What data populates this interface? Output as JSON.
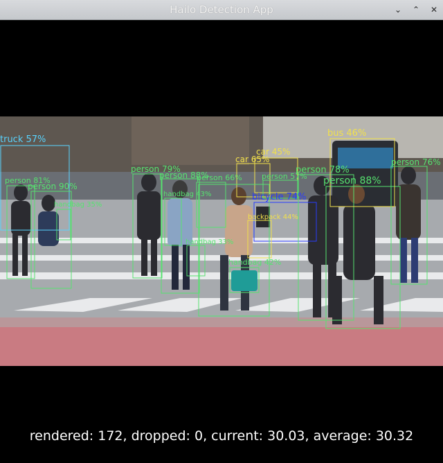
{
  "window": {
    "title": "Hailo Detection App",
    "buttons": [
      {
        "name": "minimize-icon",
        "glyph": "⌄"
      },
      {
        "name": "maximize-icon",
        "glyph": "⌃"
      },
      {
        "name": "close-icon",
        "glyph": "✕"
      }
    ]
  },
  "detections": [
    {
      "label": "truck 57%",
      "color": "#59d4ff"
    },
    {
      "label": "person 81%",
      "color": "#56e36f"
    },
    {
      "label": "person 90%",
      "color": "#56e36f"
    },
    {
      "label": "handbag 35%",
      "color": "#56e36f"
    },
    {
      "label": "person 79%",
      "color": "#56e36f"
    },
    {
      "label": "person 88%",
      "color": "#56e36f"
    },
    {
      "label": "handbag 43%",
      "color": "#56e36f"
    },
    {
      "label": "person 66%",
      "color": "#56e36f"
    },
    {
      "label": "handbag 33%",
      "color": "#56e36f"
    },
    {
      "label": "car 65%",
      "color": "#f2e14b"
    },
    {
      "label": "car 45%",
      "color": "#f2e14b"
    },
    {
      "label": "person 57%",
      "color": "#56e36f"
    },
    {
      "label": "bicycle 74%",
      "color": "#2a3cff"
    },
    {
      "label": "backpack 44%",
      "color": "#f2e14b"
    },
    {
      "label": "handbag 42%",
      "color": "#56e36f"
    },
    {
      "label": "person 78%",
      "color": "#56e36f"
    },
    {
      "label": "person 88%",
      "color": "#56e36f"
    },
    {
      "label": "bus 46%",
      "color": "#f2e14b"
    },
    {
      "label": "person 76%",
      "color": "#56e36f"
    }
  ],
  "status": {
    "text": "rendered: 172, dropped: 0, current: 30.03, average: 30.32"
  }
}
